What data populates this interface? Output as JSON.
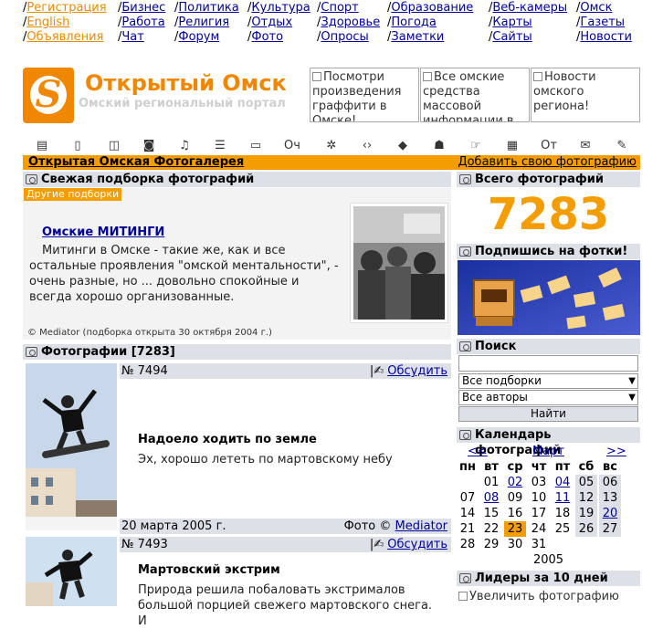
{
  "nav": {
    "columns": [
      [
        "Регистрация",
        "English",
        "Объявления"
      ],
      [
        "Бизнес",
        "Работа",
        "Чат"
      ],
      [
        "Политика",
        "Религия",
        "Форум"
      ],
      [
        "Культура",
        "Отдых",
        "Фото"
      ],
      [
        "Спорт",
        "Здоровье",
        "Опросы"
      ],
      [
        "Образование",
        "Погода",
        "Заметки"
      ],
      [
        "Веб-камеры",
        "Карты",
        "Сайты"
      ],
      [
        "Омск",
        "Газеты",
        "Новости"
      ]
    ]
  },
  "site": {
    "title": "Открытый Омск",
    "subtitle": "Омский региональный портал"
  },
  "ads": [
    "Посмотри произведения граффити в Омске!",
    "Все омские средства массовой информации в",
    "Новости омского региона!"
  ],
  "iconbar": [
    "Оч",
    "От"
  ],
  "orange_bar": {
    "left": "Открытая Омская Фотогалерея",
    "right": "Добавить свою фотографию"
  },
  "fresh": {
    "header": "Свежая подборка фотографий",
    "tag": "Другие подборки",
    "title": "Омские МИТИНГИ",
    "text": "Митинги в Омске - такие же, как и все остальные проявления \"омской ментальности\", - очень разные, но ... довольно спокойные и всегда хорошо организованные.",
    "credit": "© Mediator (подборка открыта 30 октября 2004 г.)"
  },
  "photos": {
    "header": "Фотографии [7283]",
    "items": [
      {
        "number": "№ 7494",
        "discuss": "Обсудить",
        "title": "Надоело ходить по земле",
        "desc": "Эх, хорошо лететь по мартовскому небу",
        "date": "20 марта 2005 г.",
        "credit_prefix": "Фото ©",
        "author": "Mediator"
      },
      {
        "number": "№ 7493",
        "discuss": "Обсудить",
        "title": "Мартовский экстрим",
        "desc": "Природа решила побаловать экстрималов большой порцией свежего мартовского снега. И"
      }
    ]
  },
  "total": {
    "header": "Всего фотографий",
    "value": "7283"
  },
  "subscribe": {
    "header": "Подпишись на фотки!"
  },
  "search": {
    "header": "Поиск",
    "select1": "Все подборки",
    "select2": "Все авторы",
    "button": "Найти"
  },
  "calendar": {
    "header": "Календарь фотографий",
    "prev": "<<",
    "month": "Март",
    "next": ">>",
    "weekdays": [
      "пн",
      "вт",
      "ср",
      "чт",
      "пт",
      "сб",
      "вс"
    ],
    "weeks": [
      [
        "",
        "01",
        "02",
        "03",
        "04",
        "05",
        "06"
      ],
      [
        "07",
        "08",
        "09",
        "10",
        "11",
        "12",
        "13"
      ],
      [
        "14",
        "15",
        "16",
        "17",
        "18",
        "19",
        "20"
      ],
      [
        "21",
        "22",
        "23",
        "24",
        "25",
        "26",
        "27"
      ],
      [
        "28",
        "29",
        "30",
        "31",
        "",
        "",
        ""
      ]
    ],
    "linked": [
      "02",
      "04",
      "08",
      "11",
      "20"
    ],
    "today": "23",
    "year": "2005"
  },
  "leaders": {
    "header": "Лидеры за 10 дней",
    "image_alt": "Увеличить фотографию"
  },
  "colors": {
    "accent": "#f49d00",
    "header_bg": "#dde1e7",
    "link": "#000099"
  }
}
